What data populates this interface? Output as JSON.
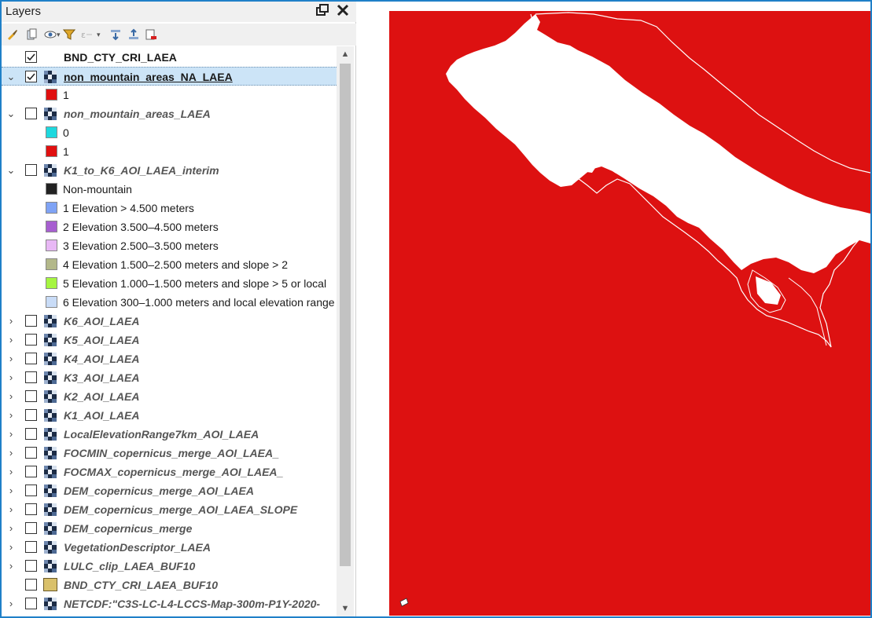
{
  "panel": {
    "title": "Layers",
    "float_label": "❐",
    "close_label": "✕"
  },
  "toolbar": {
    "icons": [
      "style-manager-icon",
      "add-group-icon",
      "manage-visibility-icon",
      "filter-legend-icon",
      "filter-expression-icon",
      "expand-all-icon",
      "collapse-all-icon",
      "remove-layer-icon"
    ]
  },
  "layers": [
    {
      "label": "BND_CTY_CRI_LAEA",
      "checked": true,
      "type": "none",
      "expander": "",
      "style": "bold"
    },
    {
      "label": "non_mountain_areas_NA_LAEA",
      "checked": true,
      "type": "raster",
      "expander": "⌄",
      "style": "selected"
    },
    {
      "legend": "1",
      "color": "#e01010"
    },
    {
      "label": "non_mountain_areas_LAEA",
      "checked": false,
      "type": "raster",
      "expander": "⌄",
      "style": "italic"
    },
    {
      "legend": "0",
      "color": "#1ed8de"
    },
    {
      "legend": "1",
      "color": "#e01010"
    },
    {
      "label": "K1_to_K6_AOI_LAEA_interim",
      "checked": false,
      "type": "raster",
      "expander": "⌄",
      "style": "italic"
    },
    {
      "legend": "Non-mountain",
      "color": "#222222"
    },
    {
      "legend": "1 Elevation > 4.500 meters",
      "color": "#7fa3f5"
    },
    {
      "legend": "2 Elevation 3.500–4.500 meters",
      "color": "#a75fd0"
    },
    {
      "legend": "3 Elevation 2.500–3.500 meters",
      "color": "#e8b8f5"
    },
    {
      "legend": "4 Elevation 1.500–2.500 meters and slope > 2",
      "color": "#b3b88a"
    },
    {
      "legend": "5 Elevation 1.000–1.500 meters and slope > 5 or local",
      "color": "#a6f541"
    },
    {
      "legend": "6 Elevation 300–1.000 meters and local elevation range",
      "color": "#c9dcf7"
    },
    {
      "label": "K6_AOI_LAEA",
      "checked": false,
      "type": "raster",
      "expander": "›",
      "style": "italic"
    },
    {
      "label": "K5_AOI_LAEA",
      "checked": false,
      "type": "raster",
      "expander": "›",
      "style": "italic"
    },
    {
      "label": "K4_AOI_LAEA",
      "checked": false,
      "type": "raster",
      "expander": "›",
      "style": "italic"
    },
    {
      "label": "K3_AOI_LAEA",
      "checked": false,
      "type": "raster",
      "expander": "›",
      "style": "italic"
    },
    {
      "label": "K2_AOI_LAEA",
      "checked": false,
      "type": "raster",
      "expander": "›",
      "style": "italic"
    },
    {
      "label": "K1_AOI_LAEA",
      "checked": false,
      "type": "raster",
      "expander": "›",
      "style": "italic"
    },
    {
      "label": "LocalElevationRange7km_AOI_LAEA",
      "checked": false,
      "type": "raster",
      "expander": "›",
      "style": "italic"
    },
    {
      "label": "FOCMIN_copernicus_merge_AOI_LAEA_",
      "checked": false,
      "type": "raster",
      "expander": "›",
      "style": "italic"
    },
    {
      "label": "FOCMAX_copernicus_merge_AOI_LAEA_",
      "checked": false,
      "type": "raster",
      "expander": "›",
      "style": "italic"
    },
    {
      "label": "DEM_copernicus_merge_AOI_LAEA",
      "checked": false,
      "type": "raster",
      "expander": "›",
      "style": "italic"
    },
    {
      "label": "DEM_copernicus_merge_AOI_LAEA_SLOPE",
      "checked": false,
      "type": "raster",
      "expander": "›",
      "style": "italic"
    },
    {
      "label": "DEM_copernicus_merge",
      "checked": false,
      "type": "raster",
      "expander": "›",
      "style": "italic"
    },
    {
      "label": "VegetationDescriptor_LAEA",
      "checked": false,
      "type": "raster",
      "expander": "›",
      "style": "italic"
    },
    {
      "label": "LULC_clip_LAEA_BUF10",
      "checked": false,
      "type": "raster",
      "expander": "›",
      "style": "italic"
    },
    {
      "label": "BND_CTY_CRI_LAEA_BUF10",
      "checked": false,
      "type": "vector",
      "expander": "",
      "style": "italic"
    },
    {
      "label": "NETCDF:\"C3S-LC-L4-LCCS-Map-300m-P1Y-2020-",
      "checked": false,
      "type": "raster",
      "expander": "›",
      "style": "italic"
    }
  ],
  "scrollbar": {
    "up_label": "▲",
    "down_label": "▼"
  },
  "colors": {
    "map_fill": "#dd1111",
    "land_mask": "#ffffff",
    "selection": "#cce4f7",
    "frame": "#1f80c8"
  }
}
